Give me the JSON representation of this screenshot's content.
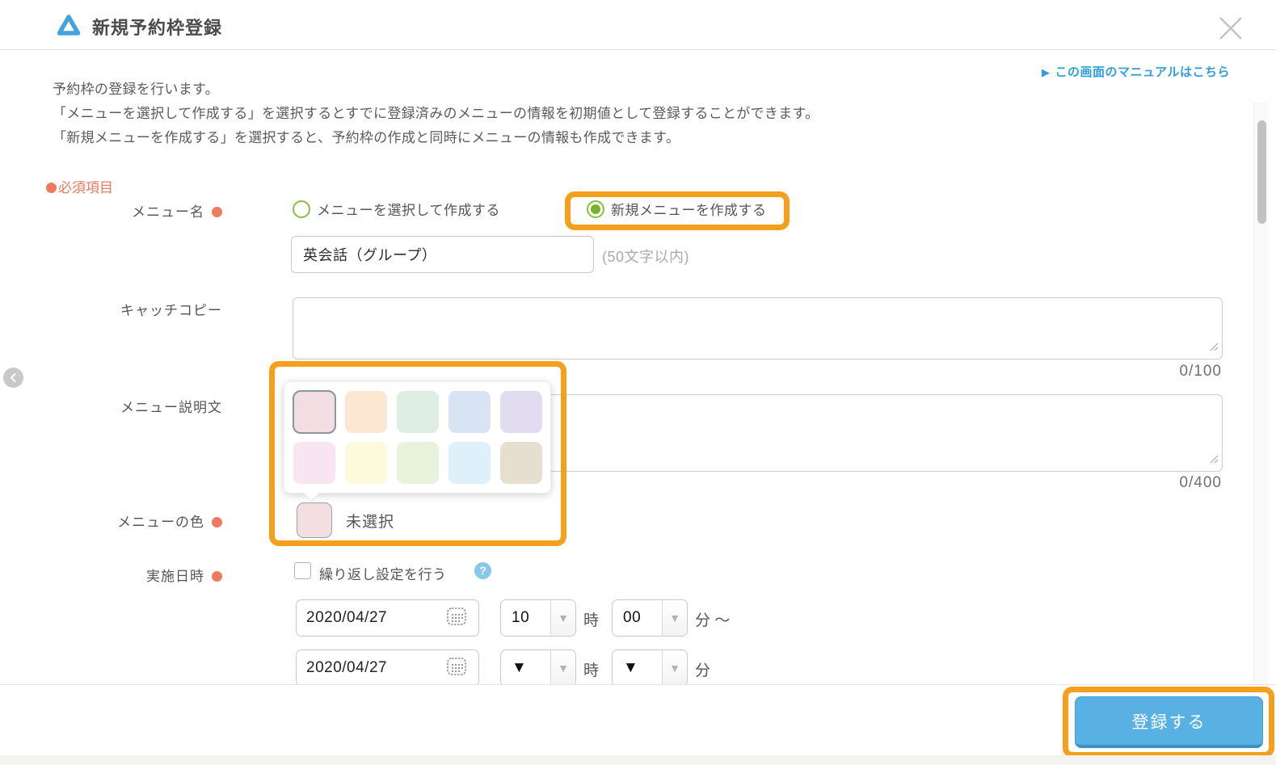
{
  "header": {
    "title": "新規予約枠登録"
  },
  "manual_link": {
    "arrow": "▶",
    "label": "この画面のマニュアルはこちら"
  },
  "intro": {
    "line1": "予約枠の登録を行います。",
    "line2": "「メニューを選択して作成する」を選択するとすでに登録済みのメニューの情報を初期値として登録することができます。",
    "line3": "「新規メニューを作成する」を選択すると、予約枠の作成と同時にメニューの情報も作成できます。"
  },
  "required_note": "必須項目",
  "form": {
    "menu_name": {
      "label": "メニュー名",
      "radio_select_existing": "メニューを選択して作成する",
      "radio_create_new": "新規メニューを作成する",
      "value": "英会話（グループ）",
      "hint": "(50文字以内)"
    },
    "catch_copy": {
      "label": "キャッチコピー",
      "value": "",
      "counter": "0/100"
    },
    "description": {
      "label": "メニュー説明文",
      "value": "",
      "counter": "0/400"
    },
    "menu_color": {
      "label": "メニューの色",
      "selected_label": "未選択"
    },
    "datetime": {
      "label": "実施日時",
      "repeat_label": "繰り返し設定を行う",
      "help": "?",
      "start_date": "2020/04/27",
      "start_hour": "10",
      "start_minute": "00",
      "hour_unit": "時",
      "minute_unit_start": "分 ～",
      "end_date": "2020/04/27",
      "end_hour_placeholder": "▼",
      "end_minute_placeholder": "▼",
      "minute_unit_end": "分",
      "dropdown_arrow": "▼"
    }
  },
  "palette": {
    "preview_color": "#f3dee1",
    "selected_index": 0,
    "colors": [
      "#f2dde2",
      "#fbe7d2",
      "#dfeee4",
      "#d8e3f4",
      "#e2dcf0",
      "#f8e5f1",
      "#fcf9dc",
      "#e9f2db",
      "#def0f9",
      "#e6decf"
    ]
  },
  "footer": {
    "submit_label": "登録する"
  },
  "colors": {
    "accent_orange": "#f5a01d",
    "link_blue": "#2e9fd9",
    "logo_blue": "#46a4dd",
    "button_blue": "#58b1e2",
    "radio_green": "#85c043",
    "required_red": "#ed7b60"
  }
}
